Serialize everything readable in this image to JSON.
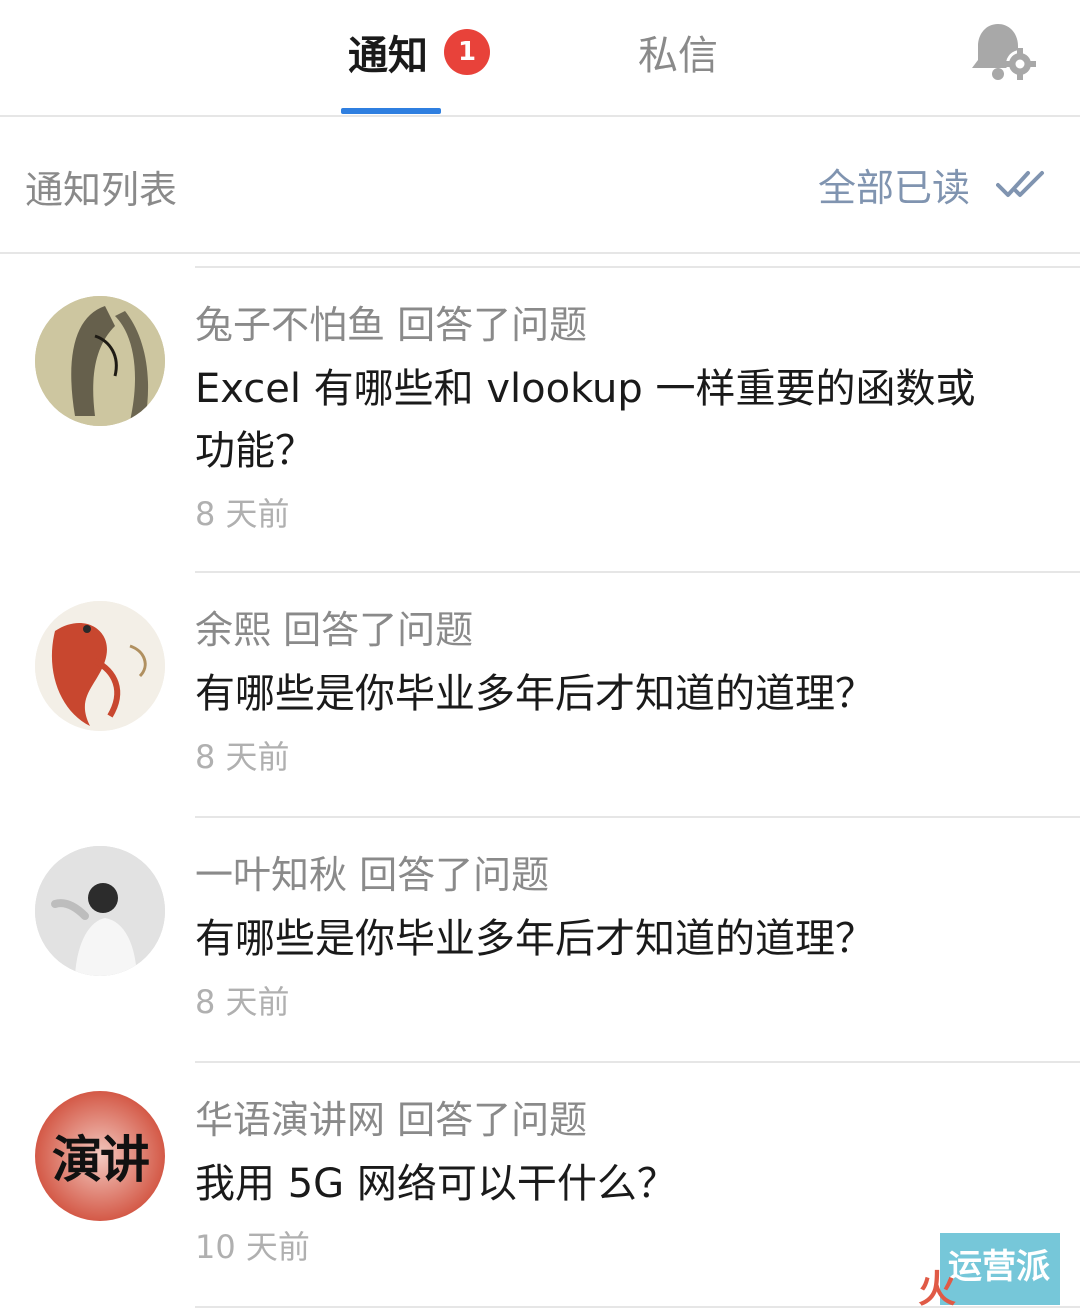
{
  "tabs": {
    "notifications_label": "通知",
    "notifications_badge": "1",
    "messages_label": "私信"
  },
  "header": {
    "title": "通知列表",
    "mark_all_read": "全部已读"
  },
  "notifications": [
    {
      "user": "兔子不怕鱼 回答了问题",
      "question_line1": "Excel 有哪些和 vlookup 一样重要的函数或",
      "question_line2": "功能？",
      "time": "8 天前"
    },
    {
      "user": "余熙 回答了问题",
      "question_line1": "有哪些是你毕业多年后才知道的道理？",
      "time": "8 天前"
    },
    {
      "user": "一叶知秋 回答了问题",
      "question_line1": "有哪些是你毕业多年后才知道的道理？",
      "time": "8 天前"
    },
    {
      "user": "华语演讲网 回答了问题",
      "question_line1": "我用 5G 网络可以干什么？",
      "time": "10 天前"
    }
  ],
  "avatar4_text": "演讲",
  "watermark": {
    "top": "运营派",
    "left": "火"
  },
  "colors": {
    "accent": "#2f7fe0",
    "badge": "#e8423a",
    "mark_all": "#8094b0"
  },
  "icons": [
    "bell-settings-icon",
    "double-check-icon"
  ]
}
